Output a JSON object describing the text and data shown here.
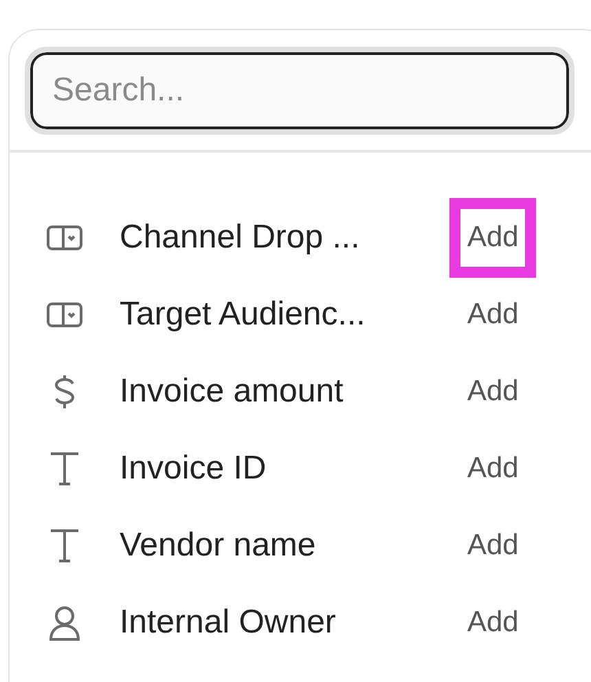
{
  "search": {
    "placeholder": "Search..."
  },
  "fields": [
    {
      "kind": "dropdown",
      "label": "Channel Drop ...",
      "action": "Add",
      "highlighted": true
    },
    {
      "kind": "dropdown",
      "label": "Target Audienc...",
      "action": "Add",
      "highlighted": false
    },
    {
      "kind": "currency",
      "label": "Invoice amount",
      "action": "Add",
      "highlighted": false
    },
    {
      "kind": "text",
      "label": "Invoice ID",
      "action": "Add",
      "highlighted": false
    },
    {
      "kind": "text",
      "label": "Vendor name",
      "action": "Add",
      "highlighted": false
    },
    {
      "kind": "person",
      "label": "Internal Owner",
      "action": "Add",
      "highlighted": false
    }
  ]
}
